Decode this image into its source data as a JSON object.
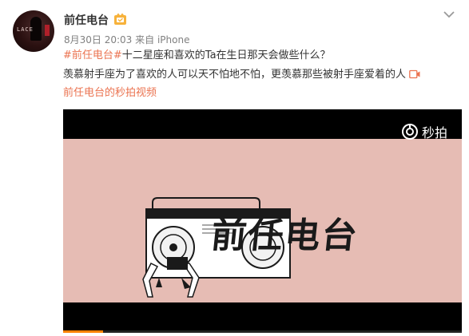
{
  "post": {
    "username": "前任电台",
    "date": "8月30日 20:03",
    "source": "来自 iPhone",
    "hashtag_1": "#前任电台#",
    "hashtag_2": "十二星座和喜欢的Ta在生日那天会做些什么？",
    "line2": "羡慕射手座为了喜欢的人可以天不怕地不怕，更羡慕那些被射手座爱着的人",
    "video_link": "前任电台的秒拍视频",
    "avatar_text": "LACE"
  },
  "video": {
    "watermark": "秒拍",
    "logo_text": "前任电台",
    "progress": 0.1
  },
  "colors": {
    "link": "#eb7350",
    "video_bg": "#e6bcb4",
    "accent_orange": "#ff8200"
  },
  "icons": {
    "verify": "verified-badge-icon",
    "menu": "chevron-down-icon",
    "video_link": "video-play-icon",
    "watermark": "miaopai-logo-icon"
  }
}
